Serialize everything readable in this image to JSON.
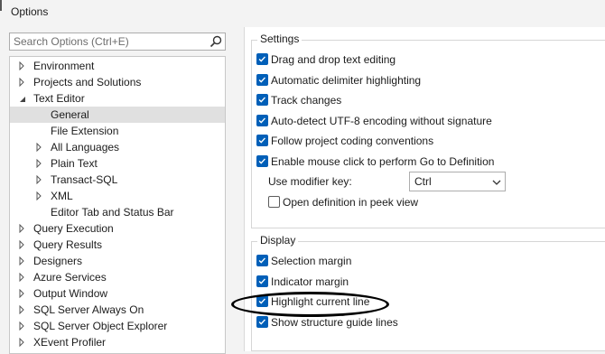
{
  "window": {
    "title": "Options"
  },
  "search": {
    "placeholder": "Search Options (Ctrl+E)"
  },
  "tree": [
    {
      "label": "Environment",
      "arrow": "right",
      "level": 0
    },
    {
      "label": "Projects and Solutions",
      "arrow": "right",
      "level": 0
    },
    {
      "label": "Text Editor",
      "arrow": "down",
      "level": 0
    },
    {
      "label": "General",
      "arrow": "none",
      "level": 1,
      "selected": true
    },
    {
      "label": "File Extension",
      "arrow": "none",
      "level": 1
    },
    {
      "label": "All Languages",
      "arrow": "right",
      "level": 1
    },
    {
      "label": "Plain Text",
      "arrow": "right",
      "level": 1
    },
    {
      "label": "Transact-SQL",
      "arrow": "right",
      "level": 1
    },
    {
      "label": "XML",
      "arrow": "right",
      "level": 1
    },
    {
      "label": "Editor Tab and Status Bar",
      "arrow": "none",
      "level": 1
    },
    {
      "label": "Query Execution",
      "arrow": "right",
      "level": 0
    },
    {
      "label": "Query Results",
      "arrow": "right",
      "level": 0
    },
    {
      "label": "Designers",
      "arrow": "right",
      "level": 0
    },
    {
      "label": "Azure Services",
      "arrow": "right",
      "level": 0
    },
    {
      "label": "Output Window",
      "arrow": "right",
      "level": 0
    },
    {
      "label": "SQL Server Always On",
      "arrow": "right",
      "level": 0
    },
    {
      "label": "SQL Server Object Explorer",
      "arrow": "right",
      "level": 0
    },
    {
      "label": "XEvent Profiler",
      "arrow": "right",
      "level": 0
    }
  ],
  "settings": {
    "title": "Settings",
    "options": [
      {
        "label": "Drag and drop text editing",
        "checked": true
      },
      {
        "label": "Automatic delimiter highlighting",
        "checked": true
      },
      {
        "label": "Track changes",
        "checked": true
      },
      {
        "label": "Auto-detect UTF-8 encoding without signature",
        "checked": true
      },
      {
        "label": "Follow project coding conventions",
        "checked": true
      },
      {
        "label": "Enable mouse click to perform Go to Definition",
        "checked": true
      }
    ],
    "modifier_key_label": "Use modifier key:",
    "modifier_key_value": "Ctrl",
    "peek_option": {
      "label": "Open definition in peek view",
      "checked": false
    }
  },
  "display": {
    "title": "Display",
    "options": [
      {
        "label": "Selection margin",
        "checked": true
      },
      {
        "label": "Indicator margin",
        "checked": true
      },
      {
        "label": "Highlight current line",
        "checked": true
      },
      {
        "label": "Show structure guide lines",
        "checked": true
      }
    ]
  },
  "colors": {
    "accent": "#005fb8",
    "selected_row": "#e0e0e0"
  }
}
